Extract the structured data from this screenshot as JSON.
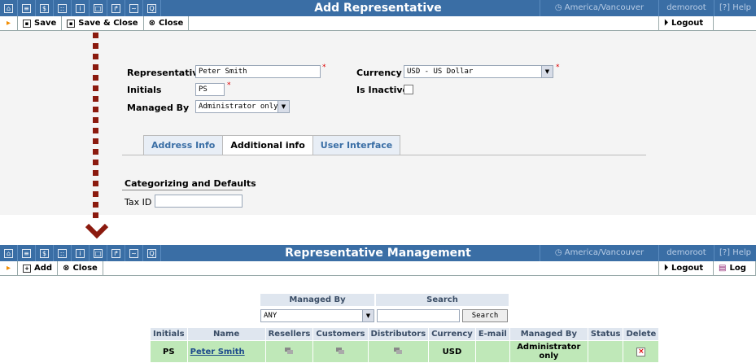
{
  "top": {
    "title": "Add Representative",
    "timezone": "America/Vancouver",
    "user": "demoroot",
    "help": "Help",
    "nav_icons": [
      "home-icon",
      "list-icon",
      "dollar-icon",
      "grid-icon",
      "person-icon",
      "document-icon",
      "export-icon",
      "chart-icon",
      "search-icon"
    ]
  },
  "toolbar": {
    "save": "Save",
    "save_close": "Save & Close",
    "close": "Close",
    "logout": "Logout"
  },
  "form": {
    "representative_label": "Representative",
    "representative_value": "Peter Smith",
    "initials_label": "Initials",
    "initials_value": "PS",
    "managed_by_label": "Managed By",
    "managed_by_value": "Administrator only",
    "currency_label": "Currency",
    "currency_value": "USD - US Dollar",
    "is_inactive_label": "Is Inactive",
    "required_mark": "*"
  },
  "tabs": [
    "Address Info",
    "Additional info",
    "User Interface"
  ],
  "additional": {
    "section_title": "Categorizing and Defaults",
    "tax_id_label": "Tax ID",
    "tax_id_value": ""
  },
  "bottom_top": {
    "title": "Representative Management",
    "timezone": "America/Vancouver",
    "user": "demoroot",
    "help": "Help"
  },
  "bottom_toolbar": {
    "add": "Add",
    "close": "Close",
    "logout": "Logout",
    "log": "Log"
  },
  "filter": {
    "managed_by_header": "Managed By",
    "search_header": "Search",
    "managed_by_value": "ANY",
    "search_value": "",
    "search_button": "Search"
  },
  "table": {
    "headers": [
      "Initials",
      "Name",
      "Resellers",
      "Customers",
      "Distributors",
      "Currency",
      "E-mail",
      "Managed By",
      "Status",
      "Delete"
    ],
    "rows": [
      {
        "initials": "PS",
        "name": "Peter Smith",
        "currency": "USD",
        "email": "",
        "managed_by": "Administrator only",
        "status": ""
      }
    ]
  }
}
